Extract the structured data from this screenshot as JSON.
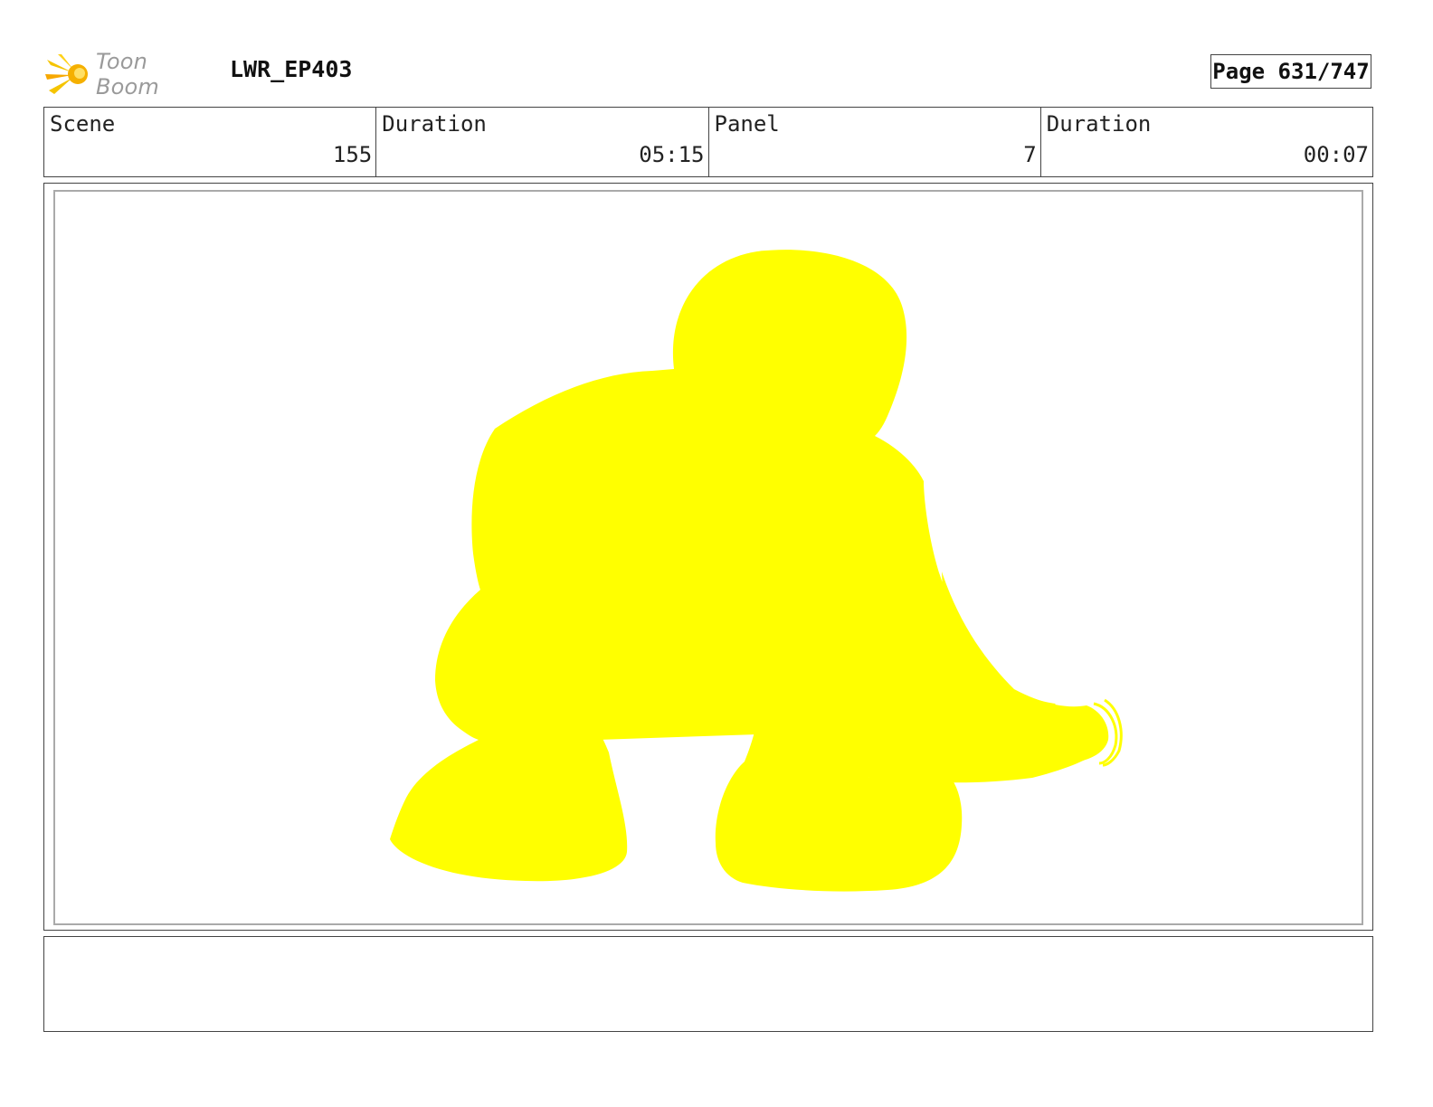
{
  "header": {
    "logo_text": "Toon Boom",
    "project_title": "LWR_EP403",
    "page_label": "Page 631/747"
  },
  "info": {
    "scene_label": "Scene",
    "scene_value": "155",
    "scene_duration_label": "Duration",
    "scene_duration_value": "05:15",
    "panel_label": "Panel",
    "panel_value": "7",
    "panel_duration_label": "Duration",
    "panel_duration_value": "00:07"
  },
  "colors": {
    "silhouette": "#ffff00",
    "logo_accent": "#f5b800",
    "logo_text": "#9a9a9a"
  },
  "icons": [
    "toon-boom-logo-icon"
  ],
  "notes": ""
}
